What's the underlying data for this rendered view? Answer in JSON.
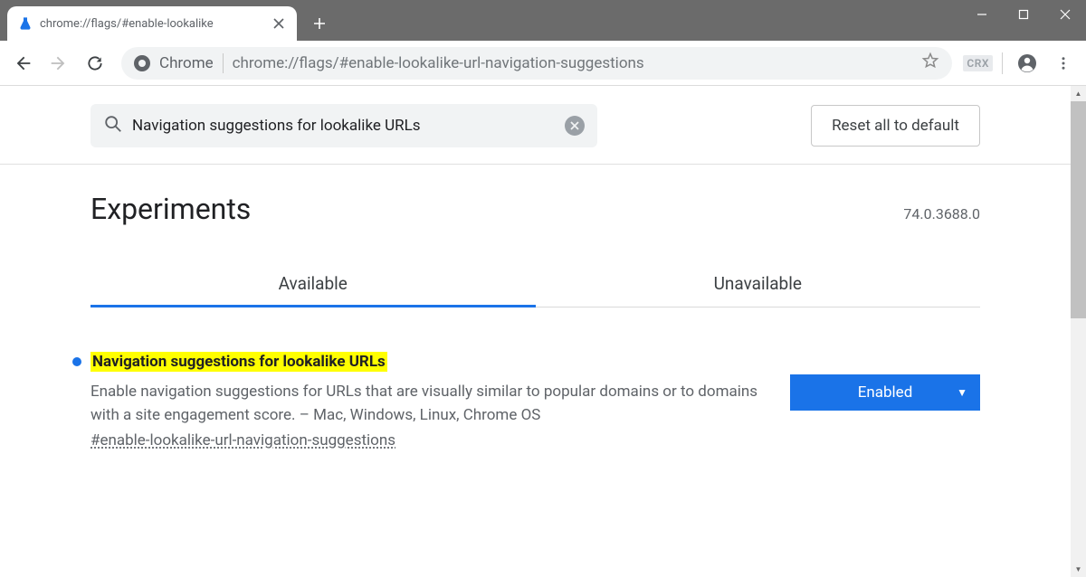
{
  "window": {
    "tab_title": "chrome://flags/#enable-lookalike"
  },
  "toolbar": {
    "omnibox_label": "Chrome",
    "url": "chrome://flags/#enable-lookalike-url-navigation-suggestions",
    "crx_badge": "CRX"
  },
  "flags_page": {
    "search_value": "Navigation suggestions for lookalike URLs",
    "reset_button": "Reset all to default",
    "heading": "Experiments",
    "version": "74.0.3688.0",
    "tabs": {
      "available": "Available",
      "unavailable": "Unavailable"
    },
    "entry": {
      "title": "Navigation suggestions for lookalike URLs",
      "description": "Enable navigation suggestions for URLs that are visually similar to popular domains or to domains with a site engagement score. – Mac, Windows, Linux, Chrome OS",
      "anchor": "#enable-lookalike-url-navigation-suggestions",
      "state": "Enabled"
    }
  }
}
